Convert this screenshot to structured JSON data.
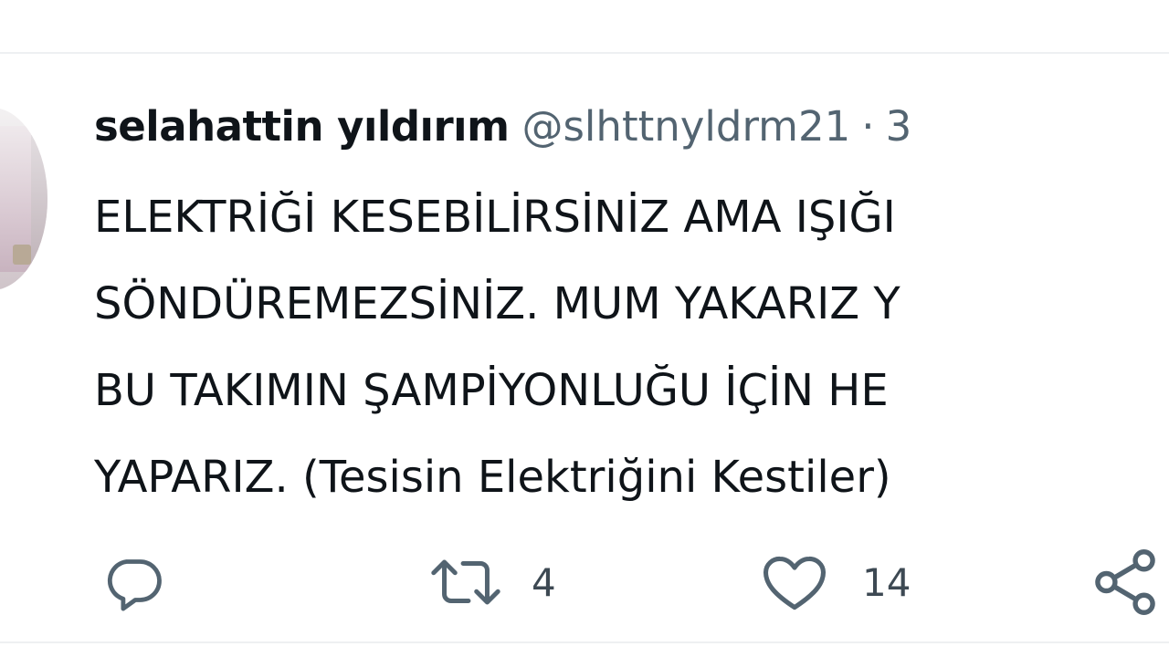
{
  "tweet": {
    "author_name": "selahattin yıldırım",
    "author_handle": "@slhttnyldrm21",
    "separator": "·",
    "time": "3",
    "body_lines": [
      "ELEKTRİĞİ KESEBİLİRSİNİZ AMA IŞIĞI",
      "SÖNDÜREMEZSİNİZ. MUM YAKARIZ Y",
      "BU TAKIMIN ŞAMPİYONLUĞU İÇİN HE",
      "YAPARIZ. (Tesisin Elektriğini Kestiler)"
    ]
  },
  "actions": {
    "reply": {
      "icon": "reply-icon",
      "count": ""
    },
    "retweet": {
      "icon": "retweet-icon",
      "count": "4"
    },
    "like": {
      "icon": "heart-icon",
      "count": "14"
    },
    "share": {
      "icon": "share-icon"
    }
  },
  "colors": {
    "text_primary": "#0f1419",
    "text_secondary": "#536471",
    "divider": "#eef0f2"
  }
}
